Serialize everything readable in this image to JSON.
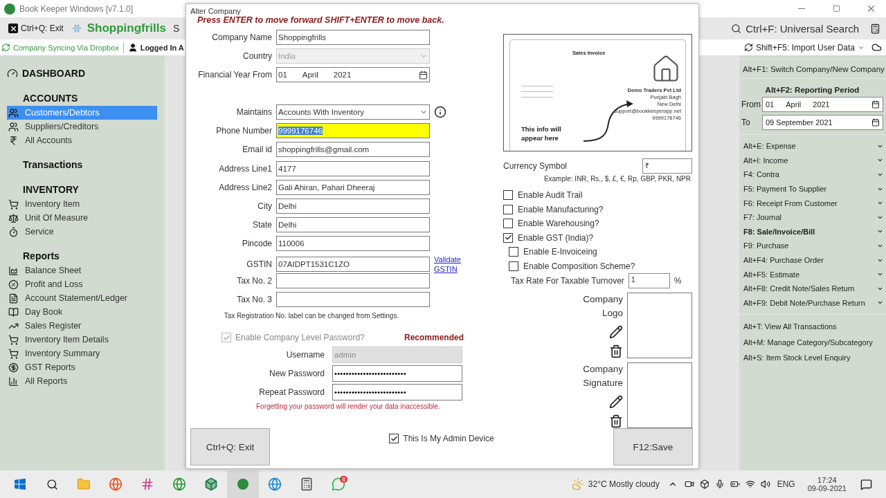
{
  "window": {
    "title": "Book Keeper Windows [v7.1.0]"
  },
  "toolbar": {
    "exit": "Ctrl+Q: Exit",
    "company": "Shoppingfrills",
    "cut_text": "S",
    "search": "Ctrl+F: Universal Search"
  },
  "status_bar": {
    "sync": "Company Syncing Via Dropbox",
    "user": "Logged In A",
    "import": "Shift+F5: Import User Data"
  },
  "sidebar": {
    "sections": [
      {
        "title": "DASHBOARD",
        "kind": "link"
      },
      {
        "title": "ACCOUNTS",
        "kind": "group",
        "items": [
          {
            "label": "Customers/Debtors",
            "selected": true
          },
          {
            "label": "Suppliers/Creditors",
            "selected": false
          },
          {
            "label": "All Accounts",
            "selected": false
          }
        ]
      },
      {
        "title": "Transactions",
        "kind": "group"
      },
      {
        "title": "INVENTORY",
        "kind": "group",
        "items": [
          {
            "label": "Inventory Item",
            "selected": false
          },
          {
            "label": "Unit Of Measure",
            "selected": false
          },
          {
            "label": "Service",
            "selected": false
          }
        ]
      },
      {
        "title": "Reports",
        "kind": "group",
        "items": [
          {
            "label": "Balance Sheet",
            "selected": false
          },
          {
            "label": "Profit and Loss",
            "selected": false
          },
          {
            "label": "Account Statement/Ledger",
            "selected": false
          },
          {
            "label": "Day Book",
            "selected": false
          },
          {
            "label": "Sales Register",
            "selected": false
          },
          {
            "label": "Inventory Item Details",
            "selected": false
          },
          {
            "label": "Inventory Summary",
            "selected": false
          },
          {
            "label": "GST Reports",
            "selected": false
          },
          {
            "label": "All Reports",
            "selected": false
          }
        ]
      }
    ]
  },
  "right_panel": {
    "switch": "Alt+F1: Switch Company/New Company",
    "period": {
      "title": "Alt+F2: Reporting Period",
      "from_label": "From",
      "from": [
        "01",
        "April",
        "2021"
      ],
      "to_label": "To",
      "to": "09 September 2021"
    },
    "vouchers": [
      {
        "label": "Alt+E: Expense",
        "bold": false
      },
      {
        "label": "Alt+I: Income",
        "bold": false
      },
      {
        "label": "F4: Contra",
        "bold": false
      },
      {
        "label": "F5: Payment To Supplier",
        "bold": false
      },
      {
        "label": "F6: Receipt From Customer",
        "bold": false
      },
      {
        "label": "F7: Journal",
        "bold": false
      },
      {
        "label": "F8: Sale/Invoice/Bill",
        "bold": true
      },
      {
        "label": "F9: Purchase",
        "bold": false
      },
      {
        "label": "Alt+F4: Purchase Order",
        "bold": false
      },
      {
        "label": "Alt+F5: Estimate",
        "bold": false
      },
      {
        "label": "Alt+F8: Credit Note/Sales Return",
        "bold": false
      },
      {
        "label": "Alt+F9: Debit Note/Purchase Return",
        "bold": false
      }
    ],
    "actions": [
      "Alt+T: View All Transactions",
      "Alt+M: Manage Category/Subcategory",
      "Alt+S: Item Stock Level Enquiry"
    ]
  },
  "dialog": {
    "title": "Alter Company",
    "hint": "Press ENTER to move forward  SHIFT+ENTER to move back.",
    "company_fields": [
      {
        "label": "Company Name",
        "kind": "text",
        "value": "Shoppingfrills",
        "disabled": false,
        "focused": false
      },
      {
        "label": "Country",
        "kind": "select",
        "value": "India",
        "disabled": true,
        "focused": false
      },
      {
        "label": "Financial Year From",
        "kind": "date",
        "parts": [
          "01",
          "April",
          "2021"
        ],
        "disabled": false,
        "focused": false
      }
    ],
    "contact_fields": [
      {
        "label": "Maintains",
        "kind": "select",
        "value": "Accounts With Inventory",
        "disabled": false,
        "focused": false
      },
      {
        "label": "Phone Number",
        "kind": "text",
        "value": "9999176746",
        "disabled": false,
        "focused": true
      },
      {
        "label": "Email id",
        "kind": "text",
        "value": "shoppingfrills@gmail.com",
        "disabled": false,
        "focused": false
      },
      {
        "label": "Address Line1",
        "kind": "text",
        "value": "4177",
        "disabled": false,
        "focused": false
      },
      {
        "label": "Address Line2",
        "kind": "text",
        "value": "Gali Ahiran, Pahari Dheeraj",
        "disabled": false,
        "focused": false
      },
      {
        "label": "City",
        "kind": "text",
        "value": "Delhi",
        "disabled": false,
        "focused": false
      },
      {
        "label": "State",
        "kind": "text",
        "value": "Delhi",
        "disabled": false,
        "focused": false
      },
      {
        "label": "Pincode",
        "kind": "text",
        "value": "110006",
        "disabled": false,
        "focused": false
      },
      {
        "label": "GSTIN",
        "kind": "text",
        "value": "07AIDPT1531C1ZO",
        "disabled": false,
        "focused": false,
        "link": "Validate GSTIN"
      },
      {
        "label": "Tax No. 2",
        "kind": "text",
        "disabled": false,
        "focused": false
      },
      {
        "label": "Tax No. 3",
        "kind": "text",
        "disabled": false,
        "focused": false
      }
    ],
    "tax_note": "Tax Registration No. label can be changed from Settings.",
    "password": {
      "label": "Enable Company Level Password?",
      "checked": true,
      "disabled": true,
      "badge": "Recommended",
      "fields": [
        {
          "label": "Username",
          "value": "admin",
          "disabled": true
        },
        {
          "label": "New Password",
          "value": "•••••••••••••••••••••••••",
          "disabled": false
        },
        {
          "label": "Repeat Password",
          "value": "•••••••••••••••••••••••••",
          "disabled": false
        }
      ],
      "warning": "Forgetting your password will render your data inaccessible."
    },
    "preview": {
      "title": "Sales Invoice",
      "lines": [
        "Demo Traders Pvt Ltd",
        "Punjabi Bagh",
        "New Delhi",
        "support@bookkeeperapp.net",
        "9999176746"
      ],
      "caption": "This info will appear here"
    },
    "currency": {
      "label": "Currency Symbol",
      "value": "₹",
      "example": "Example: INR, Rs., $, £, €, Rp, GBP, PKR, NPR"
    },
    "options": [
      {
        "label": "Enable Audit Trail",
        "checked": false
      },
      {
        "label": "Enable Manufacturing?",
        "checked": false
      },
      {
        "label": "Enable Warehousing?",
        "checked": false
      },
      {
        "label": "Enable GST (India)?",
        "checked": true,
        "children": [
          {
            "label": "Enable E-Invoiceing",
            "checked": false
          },
          {
            "label": "Enable Composition Scheme?",
            "checked": false
          }
        ]
      }
    ],
    "tax_rate": {
      "label": "Tax Rate For Taxable Turnover",
      "value": "1",
      "unit": "%"
    },
    "images": [
      {
        "label": "Company Logo"
      },
      {
        "label": "Company Signature"
      }
    ],
    "admin_device": {
      "label": "This Is My Admin Device",
      "checked": true
    },
    "buttons": [
      "Ctrl+Q: Exit",
      "F12:Save"
    ]
  },
  "taskbar": {
    "badge": "8",
    "weather": "32°C Mostly cloudy",
    "language": "ENG",
    "time": "17:24",
    "date": "09-09-2021"
  }
}
